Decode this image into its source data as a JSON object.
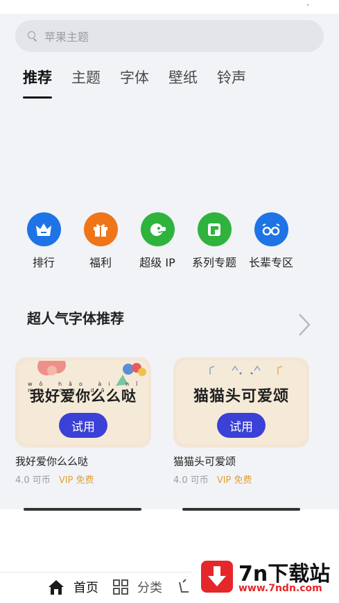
{
  "search": {
    "placeholder": "苹果主题"
  },
  "tabs": [
    {
      "label": "推荐",
      "active": true
    },
    {
      "label": "主题"
    },
    {
      "label": "字体"
    },
    {
      "label": "壁纸"
    },
    {
      "label": "铃声"
    }
  ],
  "shortcuts": [
    {
      "label": "排行",
      "icon": "crown-icon",
      "color": "#1e74e6"
    },
    {
      "label": "福利",
      "icon": "gift-icon",
      "color": "#f07418"
    },
    {
      "label": "超级 IP",
      "icon": "ip-character-icon",
      "color": "#2fb33d"
    },
    {
      "label": "系列专题",
      "icon": "series-icon",
      "color": "#2fb33d"
    },
    {
      "label": "长辈专区",
      "icon": "glasses-icon",
      "color": "#1e74e6"
    }
  ],
  "section": {
    "title": "超人气字体推荐"
  },
  "cards": [
    {
      "thumb_text": "我好爱你么么哒",
      "pinyin": "wǒ hǎo ài nǐ me me dā",
      "button": "试用",
      "title": "我好爱你么么哒",
      "price": "4.0 可币",
      "vip": "VIP 免费"
    },
    {
      "thumb_text": "猫猫头可爱颂",
      "button": "试用",
      "title": "猫猫头可爱颂",
      "price": "4.0 可币",
      "vip": "VIP 免费"
    }
  ],
  "bottom_nav": [
    {
      "label": "首页",
      "icon": "home-icon"
    },
    {
      "label": "分类",
      "icon": "grid-icon"
    }
  ],
  "watermark": {
    "brand": "7n下载站",
    "url": "www.7ndn.com"
  },
  "colors": {
    "accent_button": "#3b40d6",
    "vip": "#e0a23c",
    "background": "#f1f3f6"
  }
}
